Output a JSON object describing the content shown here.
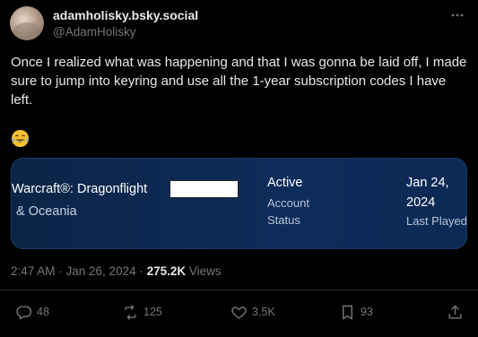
{
  "author": {
    "display_name": "adamholisky.bsky.social",
    "handle": "@AdamHolisky"
  },
  "tweet": {
    "text": "Once I realized what was happening and that I was gonna be laid off, I made sure to jump into keyring and use all the 1-year subscription codes I have left.",
    "emoji": "face-with-tears-of-joy"
  },
  "card": {
    "game_name": "Warcraft®: Dragonflight",
    "region": "& Oceania",
    "status_value": "Active",
    "status_label_1": "Account",
    "status_label_2": "Status",
    "date_line1": "Jan 24,",
    "date_line2": "2024",
    "date_label": "Last Played"
  },
  "meta": {
    "timestamp": "2:47 AM · Jan 26, 2024 · ",
    "views_count": "275.2K",
    "views_label": " Views"
  },
  "actions": {
    "replies": "48",
    "reposts": "125",
    "likes": "3.5K",
    "bookmarks": "93"
  },
  "colors": {
    "background": "#000000",
    "text": "#e7e9ea",
    "muted": "#71767b",
    "card_bg": "#0d2c5a"
  }
}
